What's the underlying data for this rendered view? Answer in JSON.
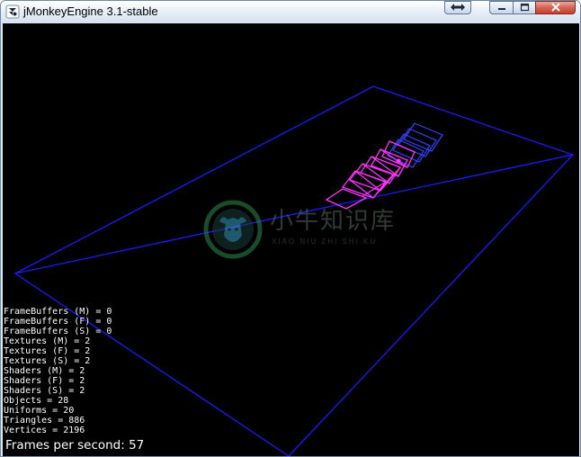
{
  "window": {
    "title": "jMonkeyEngine 3.1-stable",
    "app_icon": "jmonkey-logo-icon",
    "controls": [
      "restore-swap-icon",
      "minimize-icon",
      "maximize-icon",
      "close-icon"
    ]
  },
  "watermark": {
    "title": "小牛知识库",
    "subtitle": "XIAO NIU ZHI SHI KU",
    "icon": "bull-logo-icon"
  },
  "scene": {
    "background": "#000000",
    "plane_color": "#1a1aff",
    "mesh_color": "#ff33ff",
    "far_mesh_color": "#3344ff"
  },
  "stats": {
    "lines": [
      "FrameBuffers (M) = 0",
      "FrameBuffers (F) = 0",
      "FrameBuffers (S) = 0",
      "Textures (M) = 2",
      "Textures (F) = 2",
      "Textures (S) = 2",
      "Shaders (M) = 2",
      "Shaders (F) = 2",
      "Shaders (S) = 2",
      "Objects = 28",
      "Uniforms = 20",
      "Triangles = 886",
      "Vertices = 2196"
    ],
    "fps": "Frames per second: 57"
  }
}
